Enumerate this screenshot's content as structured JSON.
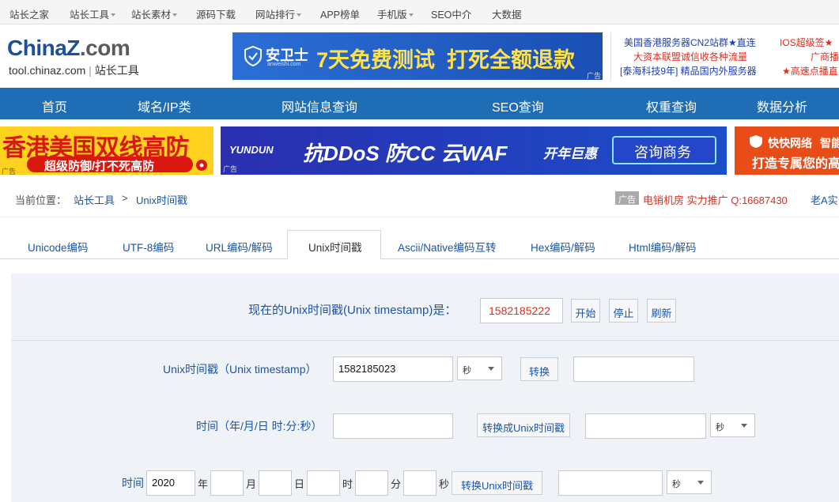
{
  "topbar": {
    "items": [
      "站长之家",
      "站长工具",
      "站长素材",
      "源码下载",
      "网站排行",
      "APP榜单",
      "手机版",
      "SEO中介",
      "大数据"
    ]
  },
  "logo": {
    "brand_a": "China",
    "brand_b": "Z",
    "brand_c": ".com",
    "domain": "tool.chinaz.com",
    "sep": "|",
    "name": "站长工具"
  },
  "ad_banner": {
    "brand": "安卫士",
    "brand_url": "anweishi.com",
    "text": "7天免费测试  打死全额退款",
    "tag": "广告"
  },
  "right_ads": [
    [
      "美国香港服务器CN2站群★直连",
      "IOS超级签★"
    ],
    [
      "大资本联盟诚信收各种流量",
      "广商播"
    ],
    [
      "[泰海科技9年] 精品国内外服务器",
      "★高速点播直"
    ]
  ],
  "nav": {
    "items": [
      "首页",
      "域名/IP类",
      "网站信息查询",
      "SEO查询",
      "权重查询",
      "数据分析"
    ]
  },
  "banners": {
    "left_title": "香港美国双线高防",
    "left_sub": "超级防御/打不死高防",
    "tag": "广告",
    "mid_brand": "YUNDUN",
    "mid_text": "抗DDoS 防CC 云WAF",
    "mid_promo": "开年巨惠",
    "mid_btn": "咨询商务",
    "right_brand": "快快网络",
    "right_brand2": "智能",
    "right_text": "打造专属您的高"
  },
  "breadcrumb": {
    "prefix": "当前位置：",
    "home": "站长工具",
    "sep": ">",
    "current": "Unix时间戳",
    "ad_tag": "广告",
    "ad_text": "电销机房 实力推广 Q:16687430",
    "ad_text2": "老A实"
  },
  "tabs": [
    "Unicode编码",
    "UTF-8编码",
    "URL编码/解码",
    "Unix时间戳",
    "Ascii/Native编码互转",
    "Hex编码/解码",
    "Html编码/解码"
  ],
  "tool": {
    "now_label": "现在的Unix时间戳(Unix timestamp)是：",
    "now_value": "1582185222",
    "start": "开始",
    "stop": "停止",
    "refresh": "刷新",
    "row1_label": "Unix时间戳（Unix timestamp）",
    "row1_value": "1582185023",
    "unit": "秒",
    "convert": "转换",
    "row2_label": "时间（年/月/日 时:分:秒）",
    "convert_unix": "转换成Unix时间戳",
    "row3_label": "时间",
    "year": "2020",
    "y": "年",
    "m": "月",
    "d": "日",
    "h": "时",
    "mi": "分",
    "s": "秒",
    "convert_unix2": "转换Unix时间戳"
  },
  "colors": {
    "nav_bg": "#1f6db4",
    "link": "#1a56a8",
    "accent_red": "#e02d1b",
    "panel_bg": "#eff2f6"
  }
}
